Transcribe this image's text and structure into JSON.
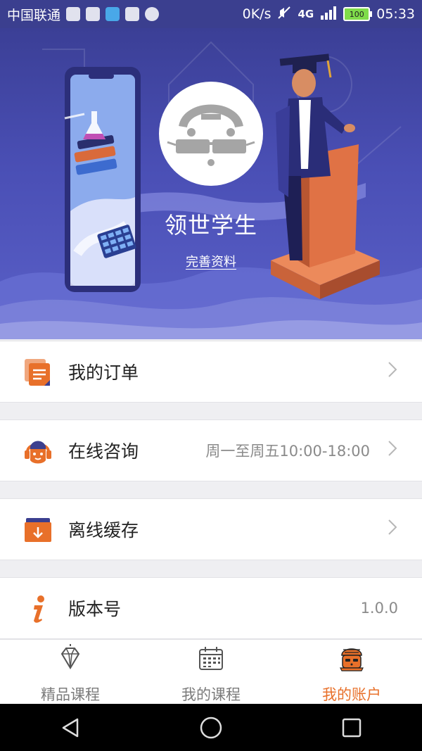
{
  "status_bar": {
    "carrier": "中国联通",
    "speed": "0K/s",
    "network": "4G",
    "battery": "100",
    "time": "05:33"
  },
  "profile": {
    "username": "领世学生",
    "complete_profile_link": "完善资料"
  },
  "menu": [
    {
      "label": "我的订单",
      "value": "",
      "icon": "orders-icon"
    },
    {
      "label": "在线咨询",
      "value": "周一至周五10:00-18:00",
      "icon": "customer-service-icon"
    },
    {
      "label": "离线缓存",
      "value": "",
      "icon": "download-box-icon"
    },
    {
      "label": "版本号",
      "value": "1.0.0",
      "icon": "info-icon"
    }
  ],
  "tabs": [
    {
      "label": "精品课程",
      "icon": "diamond-icon",
      "active": false
    },
    {
      "label": "我的课程",
      "icon": "calendar-icon",
      "active": false
    },
    {
      "label": "我的账户",
      "icon": "account-avatar-icon",
      "active": true
    }
  ],
  "colors": {
    "accent": "#e8702a",
    "hero": "#4a4fb5"
  }
}
